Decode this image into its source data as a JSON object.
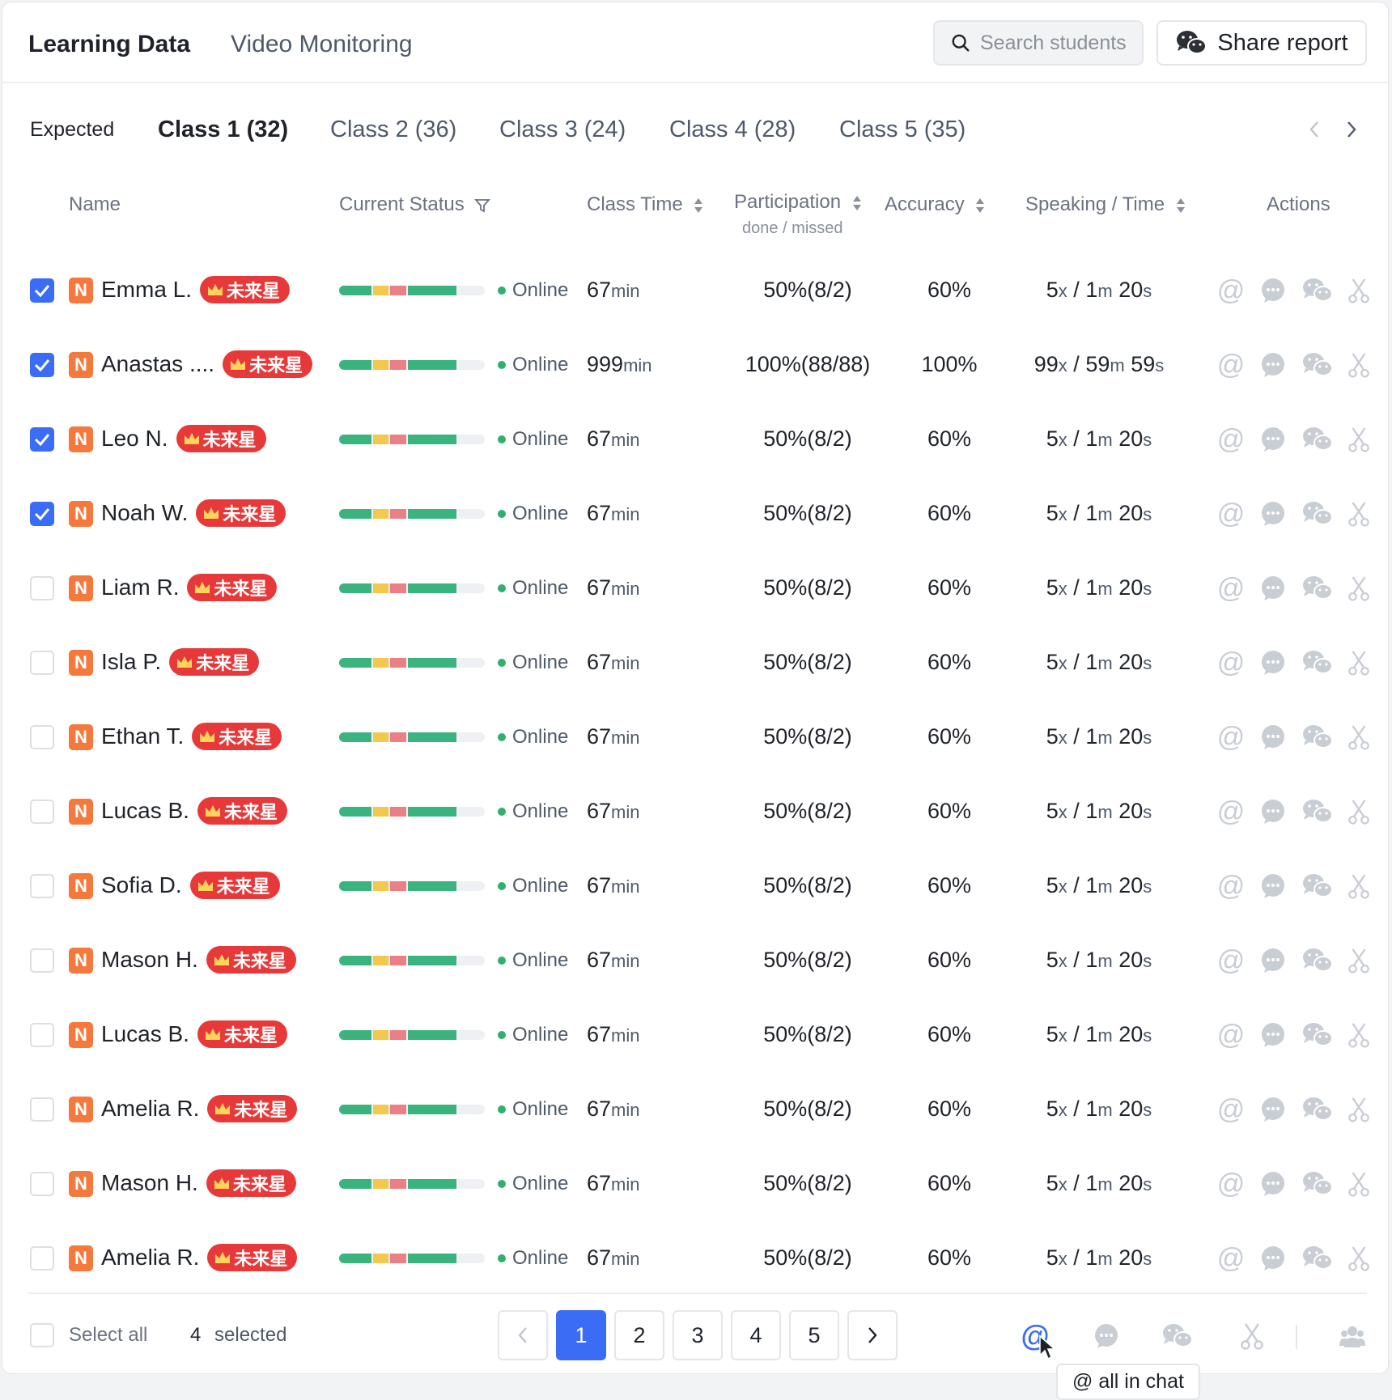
{
  "header": {
    "tabs": [
      {
        "label": "Learning Data",
        "active": true
      },
      {
        "label": "Video Monitoring",
        "active": false
      }
    ],
    "search_placeholder": "Search students",
    "share_label": "Share report"
  },
  "class_tabs": {
    "expected_label": "Expected",
    "tabs": [
      {
        "label": "Class 1 (32)",
        "active": true
      },
      {
        "label": "Class 2 (36)",
        "active": false
      },
      {
        "label": "Class 3 (24)",
        "active": false
      },
      {
        "label": "Class 4 (28)",
        "active": false
      },
      {
        "label": "Class 5 (35)",
        "active": false
      }
    ]
  },
  "table": {
    "columns": {
      "name": "Name",
      "status": "Current Status",
      "class_time": "Class Time",
      "participation": "Participation",
      "participation_sub": "done / missed",
      "accuracy": "Accuracy",
      "speaking": "Speaking / Time",
      "actions": "Actions"
    },
    "badge_text": "未来星",
    "level_letter": "N",
    "progress_colors": [
      "#3bb37f",
      "#f2c94c",
      "#eb7f85",
      "#3bb37f"
    ],
    "progress_fractions": [
      0.22,
      0.11,
      0.11,
      0.33
    ],
    "rows": [
      {
        "name": "Emma L.",
        "checked": true,
        "status": "Online",
        "time": "67",
        "time_unit": "min",
        "participation": "50%(8/2)",
        "accuracy": "60%",
        "speak_count": "5",
        "speak_min": "1",
        "speak_sec": "20"
      },
      {
        "name": "Anastas ....",
        "checked": true,
        "status": "Online",
        "time": "999",
        "time_unit": "min",
        "participation": "100%(88/88)",
        "accuracy": "100%",
        "speak_count": "99",
        "speak_min": "59",
        "speak_sec": "59"
      },
      {
        "name": "Leo N.",
        "checked": true,
        "status": "Online",
        "time": "67",
        "time_unit": "min",
        "participation": "50%(8/2)",
        "accuracy": "60%",
        "speak_count": "5",
        "speak_min": "1",
        "speak_sec": "20"
      },
      {
        "name": "Noah W.",
        "checked": true,
        "status": "Online",
        "time": "67",
        "time_unit": "min",
        "participation": "50%(8/2)",
        "accuracy": "60%",
        "speak_count": "5",
        "speak_min": "1",
        "speak_sec": "20"
      },
      {
        "name": "Liam R.",
        "checked": false,
        "status": "Online",
        "time": "67",
        "time_unit": "min",
        "participation": "50%(8/2)",
        "accuracy": "60%",
        "speak_count": "5",
        "speak_min": "1",
        "speak_sec": "20"
      },
      {
        "name": "Isla P.",
        "checked": false,
        "status": "Online",
        "time": "67",
        "time_unit": "min",
        "participation": "50%(8/2)",
        "accuracy": "60%",
        "speak_count": "5",
        "speak_min": "1",
        "speak_sec": "20"
      },
      {
        "name": "Ethan T.",
        "checked": false,
        "status": "Online",
        "time": "67",
        "time_unit": "min",
        "participation": "50%(8/2)",
        "accuracy": "60%",
        "speak_count": "5",
        "speak_min": "1",
        "speak_sec": "20"
      },
      {
        "name": "Lucas B.",
        "checked": false,
        "status": "Online",
        "time": "67",
        "time_unit": "min",
        "participation": "50%(8/2)",
        "accuracy": "60%",
        "speak_count": "5",
        "speak_min": "1",
        "speak_sec": "20"
      },
      {
        "name": "Sofia D.",
        "checked": false,
        "status": "Online",
        "time": "67",
        "time_unit": "min",
        "participation": "50%(8/2)",
        "accuracy": "60%",
        "speak_count": "5",
        "speak_min": "1",
        "speak_sec": "20"
      },
      {
        "name": "Mason H.",
        "checked": false,
        "status": "Online",
        "time": "67",
        "time_unit": "min",
        "participation": "50%(8/2)",
        "accuracy": "60%",
        "speak_count": "5",
        "speak_min": "1",
        "speak_sec": "20"
      },
      {
        "name": "Lucas B.",
        "checked": false,
        "status": "Online",
        "time": "67",
        "time_unit": "min",
        "participation": "50%(8/2)",
        "accuracy": "60%",
        "speak_count": "5",
        "speak_min": "1",
        "speak_sec": "20"
      },
      {
        "name": "Amelia R.",
        "checked": false,
        "status": "Online",
        "time": "67",
        "time_unit": "min",
        "participation": "50%(8/2)",
        "accuracy": "60%",
        "speak_count": "5",
        "speak_min": "1",
        "speak_sec": "20"
      },
      {
        "name": "Mason H.",
        "checked": false,
        "status": "Online",
        "time": "67",
        "time_unit": "min",
        "participation": "50%(8/2)",
        "accuracy": "60%",
        "speak_count": "5",
        "speak_min": "1",
        "speak_sec": "20"
      },
      {
        "name": "Amelia R.",
        "checked": false,
        "status": "Online",
        "time": "67",
        "time_unit": "min",
        "participation": "50%(8/2)",
        "accuracy": "60%",
        "speak_count": "5",
        "speak_min": "1",
        "speak_sec": "20"
      }
    ]
  },
  "footer": {
    "select_all_label": "Select all",
    "selected_count": "4",
    "selected_label": "selected",
    "pages": [
      "1",
      "2",
      "3",
      "4",
      "5"
    ],
    "current_page": "1",
    "tooltip": "@ all in chat"
  },
  "colors": {
    "accent": "#3b6cf5",
    "badge_red": "#e8393a",
    "level_orange": "#f5783c",
    "online_green": "#2fb16b",
    "icon_gray": "#c9cdd4"
  }
}
